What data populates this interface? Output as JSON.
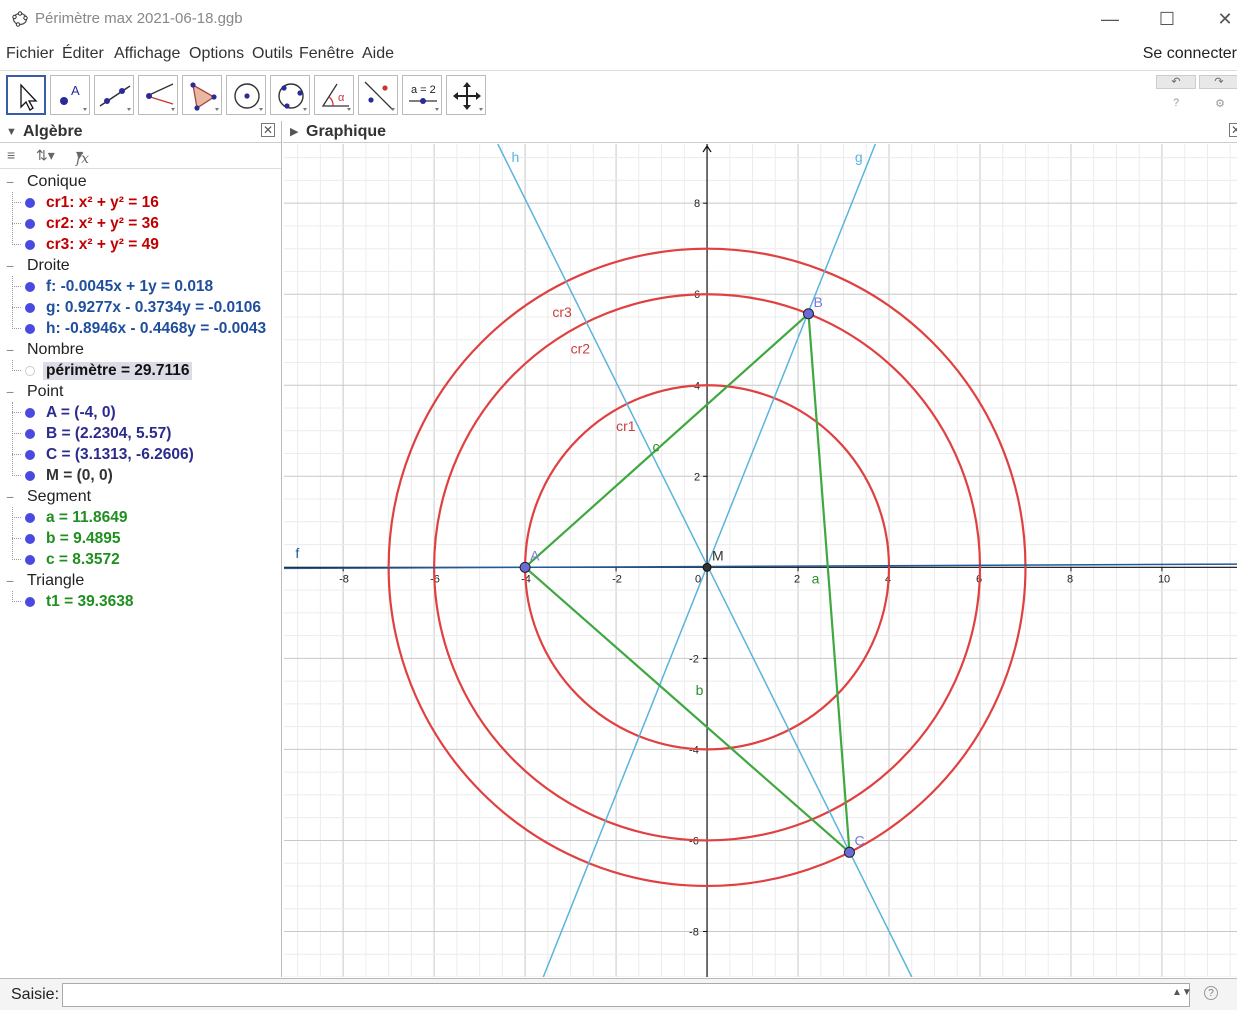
{
  "window": {
    "title": "Périmètre max 2021-06-18.ggb",
    "minimize": "—",
    "maximize": "☐",
    "close": "✕"
  },
  "menu": {
    "items": [
      "Fichier",
      "Éditer",
      "Affichage",
      "Options",
      "Outils",
      "Fenêtre",
      "Aide"
    ],
    "signin": "Se connecter"
  },
  "toolbar": {
    "tools": [
      "move-tool-icon",
      "point-tool-icon",
      "line-tool-icon",
      "perpendicular-tool-icon",
      "polygon-tool-icon",
      "circle-center-tool-icon",
      "circle-three-points-tool-icon",
      "angle-tool-icon",
      "reflect-tool-icon",
      "slider-tool-icon",
      "move-graphics-tool-icon"
    ],
    "slider_label": "a = 2",
    "undo": "↶",
    "redo": "↷",
    "help": "?",
    "settings": "⚙"
  },
  "algebra": {
    "title": "Algèbre",
    "close": "✕",
    "toolbar": {
      "sort": "≡",
      "fx": "fx"
    },
    "categories": [
      {
        "name": "Conique",
        "items": [
          {
            "text": "cr1: x² + y² = 16",
            "color": "#c00000"
          },
          {
            "text": "cr2: x² + y² = 36",
            "color": "#c00000"
          },
          {
            "text": "cr3: x² + y² = 49",
            "color": "#c00000"
          }
        ]
      },
      {
        "name": "Droite",
        "items": [
          {
            "text": "f: -0.0045x + 1y = 0.018",
            "color": "#1f4e9c"
          },
          {
            "text": "g: 0.9277x - 0.3734y = -0.0106",
            "color": "#1f4e9c"
          },
          {
            "text": "h: -0.8946x - 0.4468y = -0.0043",
            "color": "#1f4e9c"
          }
        ]
      },
      {
        "name": "Nombre",
        "items": [
          {
            "text": "périmètre = 29.7116",
            "color": "#111111",
            "selected": true,
            "hidden": true
          }
        ]
      },
      {
        "name": "Point",
        "items": [
          {
            "text": "A = (-4, 0)",
            "color": "#2b2b8c"
          },
          {
            "text": "B = (2.2304, 5.57)",
            "color": "#2b2b8c"
          },
          {
            "text": "C = (3.1313, -6.2606)",
            "color": "#2b2b8c"
          },
          {
            "text": "M = (0, 0)",
            "color": "#333333"
          }
        ]
      },
      {
        "name": "Segment",
        "items": [
          {
            "text": "a = 11.8649",
            "color": "#1f8f1f"
          },
          {
            "text": "b = 9.4895",
            "color": "#1f8f1f"
          },
          {
            "text": "c = 8.3572",
            "color": "#1f8f1f"
          }
        ]
      },
      {
        "name": "Triangle",
        "items": [
          {
            "text": "t1 = 39.3638",
            "color": "#1f8f1f"
          }
        ]
      }
    ]
  },
  "graphics": {
    "title": "Graphique",
    "close": "✕",
    "view": {
      "xmin": -9.3,
      "xmax": 11.65,
      "ymin": -9,
      "ymax": 9.3
    },
    "x_ticks": [
      -8,
      -6,
      -4,
      -2,
      0,
      2,
      4,
      6,
      8,
      10
    ],
    "y_ticks": [
      8,
      6,
      4,
      2,
      -2,
      -4,
      -6,
      -8
    ],
    "colors": {
      "circle": "#e04040",
      "line": "#5ab4dc",
      "segment": "#40a840",
      "point": "#6a6ad8",
      "grid": "#e3e3e3",
      "axis": "#111111",
      "f_line": "#1f5a9c"
    },
    "circles": [
      {
        "name": "cr1",
        "r": 4,
        "label": "cr1",
        "label_at": [
          -2,
          3
        ]
      },
      {
        "name": "cr2",
        "r": 6,
        "label": "cr2",
        "label_at": [
          -3.0,
          4.7
        ]
      },
      {
        "name": "cr3",
        "r": 7,
        "label": "cr3",
        "label_at": [
          -3.4,
          5.5
        ]
      }
    ],
    "lines": [
      {
        "name": "f",
        "label": "f",
        "p1": [
          -9.3,
          -0.024
        ],
        "p2": [
          11.65,
          0.0704
        ],
        "label_at": [
          -9.05,
          0.2
        ],
        "color": "#1f5a9c"
      },
      {
        "name": "g",
        "label": "g",
        "p1": [
          -3.6,
          -9.0
        ],
        "p2": [
          3.7,
          9.3
        ],
        "label_at": [
          3.25,
          8.9
        ],
        "color": "#5ab4dc"
      },
      {
        "name": "h",
        "label": "h",
        "p1": [
          -4.6,
          9.3
        ],
        "p2": [
          4.5,
          -9.0
        ],
        "label_at": [
          -4.3,
          8.9
        ],
        "color": "#5ab4dc"
      }
    ],
    "segments": [
      {
        "name": "a",
        "from": [
          2.2304,
          5.57
        ],
        "to": [
          3.1313,
          -6.2606
        ],
        "label": "a",
        "label_at": [
          2.3,
          -0.35
        ]
      },
      {
        "name": "b",
        "from": [
          -4,
          0
        ],
        "to": [
          3.1313,
          -6.2606
        ],
        "label": "b",
        "label_at": [
          -0.25,
          -2.8
        ]
      },
      {
        "name": "c",
        "from": [
          -4,
          0
        ],
        "to": [
          2.2304,
          5.57
        ],
        "label": "c",
        "label_at": [
          -1.2,
          2.55
        ]
      }
    ],
    "points": [
      {
        "name": "A",
        "x": -4,
        "y": 0,
        "label": "A",
        "draw": true
      },
      {
        "name": "B",
        "x": 2.2304,
        "y": 5.57,
        "label": "B",
        "draw": true
      },
      {
        "name": "C",
        "x": 3.1313,
        "y": -6.2606,
        "label": "C",
        "draw": true
      },
      {
        "name": "M",
        "x": 0,
        "y": 0,
        "label": "M",
        "draw": true,
        "dark": true
      }
    ]
  },
  "input": {
    "label": "Saisie:",
    "value": "",
    "spinner": "▲▼",
    "help": "?"
  }
}
